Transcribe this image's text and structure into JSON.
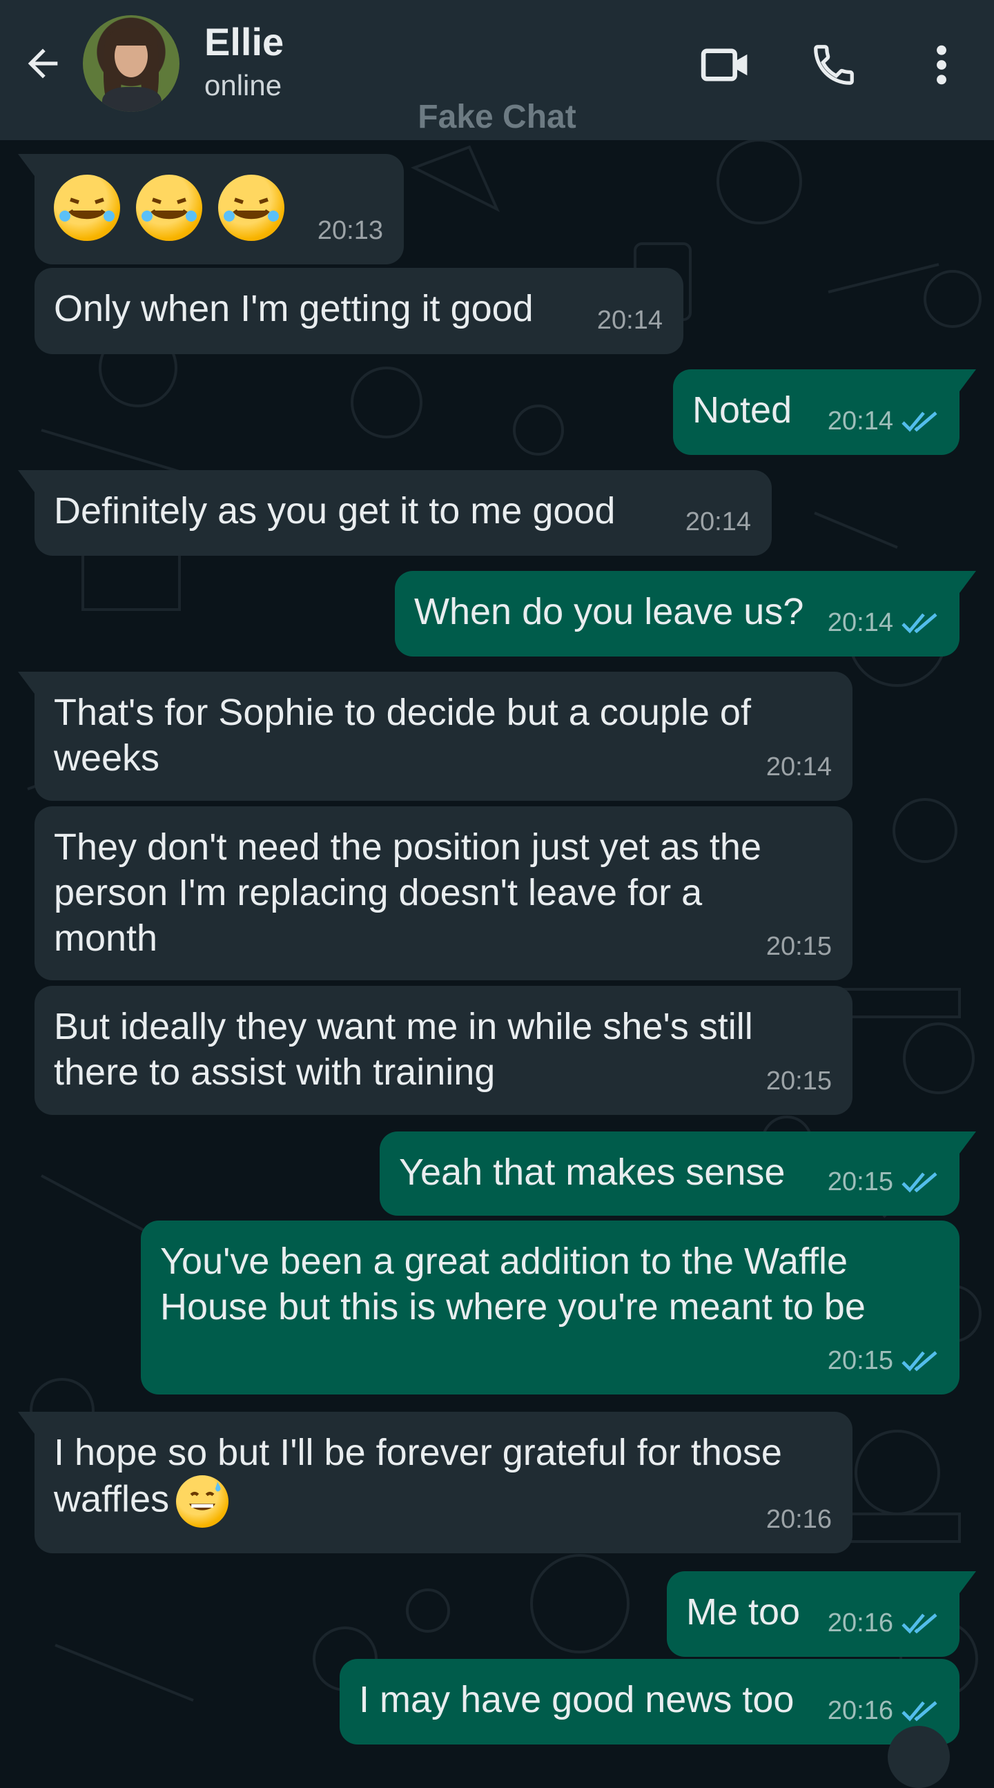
{
  "header": {
    "contact_name": "Ellie",
    "contact_status": "online",
    "watermark": "Fake Chat",
    "icons": [
      "back-arrow-icon",
      "video-call-icon",
      "voice-call-icon",
      "more-options-icon"
    ]
  },
  "colors": {
    "header_bg": "#1f2c34",
    "chat_bg": "#0b141a",
    "incoming_bubble": "#202c33",
    "outgoing_bubble": "#005c4b",
    "read_ticks": "#53bdeb"
  },
  "messages": [
    {
      "direction": "in",
      "text": "",
      "emoji": "rolling-on-floor-laughing x3",
      "time": "20:13"
    },
    {
      "direction": "in",
      "text": "Only when I'm getting it good",
      "time": "20:14"
    },
    {
      "direction": "out",
      "text": "Noted",
      "time": "20:14",
      "status": "read"
    },
    {
      "direction": "in",
      "text": "Definitely as you get it to me good",
      "time": "20:14"
    },
    {
      "direction": "out",
      "text": "When do you leave us?",
      "time": "20:14",
      "status": "read"
    },
    {
      "direction": "in",
      "text": "That's for Sophie to decide but a couple of\nweeks",
      "time": "20:14"
    },
    {
      "direction": "in",
      "text": "They don't need the position just yet as the\nperson I'm replacing doesn't leave for a\nmonth",
      "time": "20:15"
    },
    {
      "direction": "in",
      "text": "But ideally they want me in while she's still\nthere to assist with training",
      "time": "20:15"
    },
    {
      "direction": "out",
      "text": "Yeah that makes sense",
      "time": "20:15",
      "status": "read"
    },
    {
      "direction": "out",
      "text": "You've been a great addition to the Waffle\nHouse but this is where you're meant to be",
      "time": "20:15",
      "status": "read"
    },
    {
      "direction": "in",
      "text": "I hope so but I'll be forever grateful for those\nwaffles",
      "emoji": "grinning-face-with-sweat",
      "time": "20:16"
    },
    {
      "direction": "out",
      "text": "Me too",
      "time": "20:16",
      "status": "read"
    },
    {
      "direction": "out",
      "text": "I may have good news too",
      "time": "20:16",
      "status": "read"
    }
  ]
}
